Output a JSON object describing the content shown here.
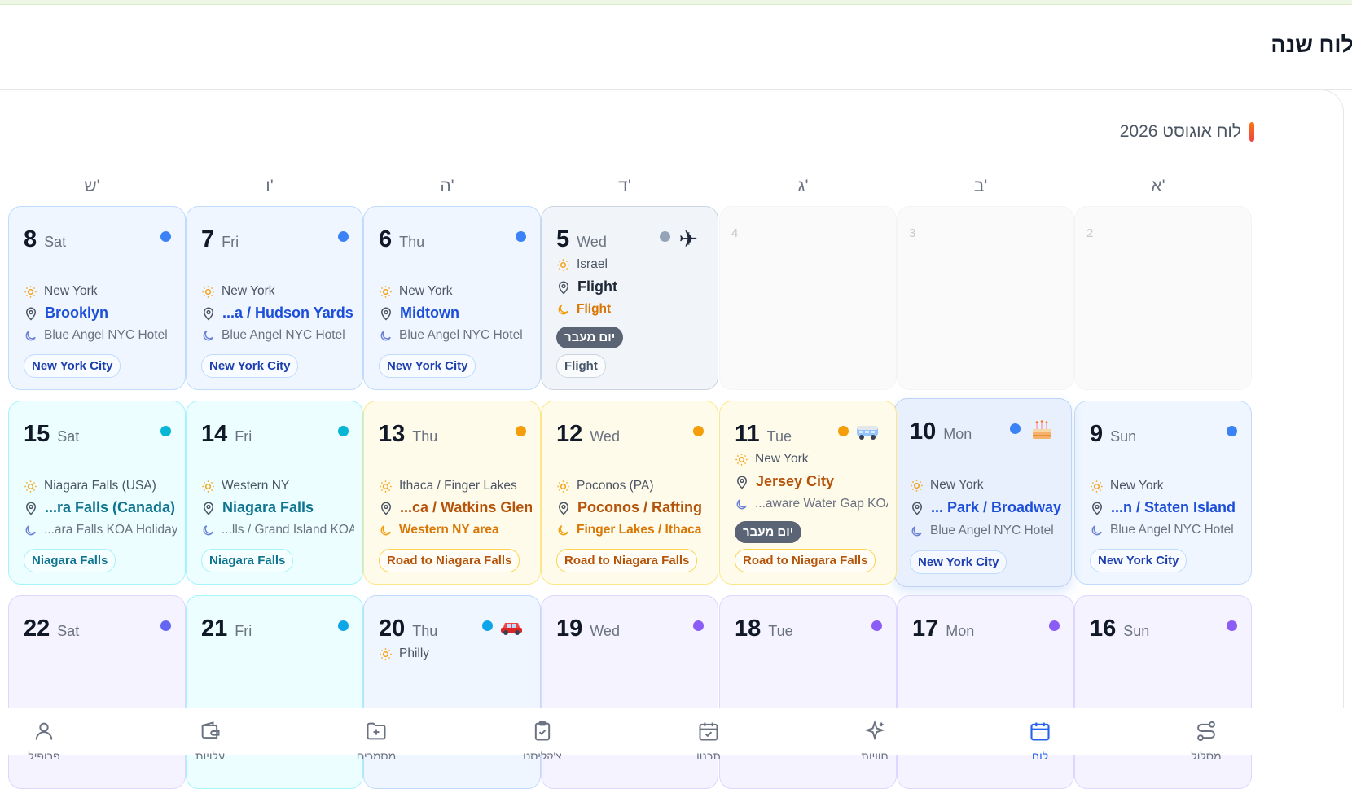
{
  "header": {
    "title": "לוח שנה"
  },
  "calendar": {
    "month_title": "לוח אוגוסט 2026",
    "weekdays": [
      "א'",
      "ב'",
      "ג'",
      "ד'",
      "ה'",
      "ו'",
      "ש'"
    ],
    "days": {
      "d2": {
        "num": "2"
      },
      "d3": {
        "num": "3"
      },
      "d4": {
        "num": "4"
      },
      "d5": {
        "num": "5",
        "name": "Wed",
        "city": "Israel",
        "location": "Flight",
        "hotel": "Flight",
        "badge": "יום מעבר",
        "tag": "Flight",
        "icon": "airplane-icon",
        "dot_color": "#94a3b8"
      },
      "d6": {
        "num": "6",
        "name": "Thu",
        "city": "New York",
        "location": "Midtown",
        "hotel": "Blue Angel NYC Hotel",
        "tag": "New York City",
        "dot_color": "#3b82f6"
      },
      "d7": {
        "num": "7",
        "name": "Fri",
        "city": "New York",
        "location": "...a / Hudson Yards",
        "hotel": "Blue Angel NYC Hotel",
        "tag": "New York City",
        "dot_color": "#3b82f6"
      },
      "d8": {
        "num": "8",
        "name": "Sat",
        "city": "New York",
        "location": "Brooklyn",
        "hotel": "Blue Angel NYC Hotel",
        "tag": "New York City",
        "dot_color": "#3b82f6"
      },
      "d9": {
        "num": "9",
        "name": "Sun",
        "city": "New York",
        "location": "...n / Staten Island",
        "hotel": "Blue Angel NYC Hotel",
        "tag": "New York City",
        "dot_color": "#3b82f6"
      },
      "d10": {
        "num": "10",
        "name": "Mon",
        "city": "New York",
        "location": "... Park / Broadway",
        "hotel": "Blue Angel NYC Hotel",
        "tag": "New York City",
        "icon": "birthday-cake-icon",
        "dot_color": "#3b82f6"
      },
      "d11": {
        "num": "11",
        "name": "Tue",
        "city": "New York",
        "location": "Jersey City",
        "hotel": "...aware Water Gap KOA",
        "badge": "יום מעבר",
        "tag": "Road to Niagara Falls",
        "icon": "minibus-icon",
        "dot_color": "#f59e0b"
      },
      "d12": {
        "num": "12",
        "name": "Wed",
        "city": "Poconos (PA)",
        "location": "Poconos / Rafting",
        "hotel": "Finger Lakes / Ithaca",
        "tag": "Road to Niagara Falls",
        "dot_color": "#f59e0b"
      },
      "d13": {
        "num": "13",
        "name": "Thu",
        "city": "Ithaca / Finger Lakes",
        "location": "...ca / Watkins Glen",
        "hotel": "Western NY area",
        "tag": "Road to Niagara Falls",
        "dot_color": "#f59e0b"
      },
      "d14": {
        "num": "14",
        "name": "Fri",
        "city": "Western NY",
        "location": "Niagara Falls",
        "hotel": "...lls / Grand Island KOA",
        "tag": "Niagara Falls",
        "dot_color": "#06b6d4"
      },
      "d15": {
        "num": "15",
        "name": "Sat",
        "city": "Niagara Falls (USA)",
        "location": "...ra Falls (Canada)",
        "hotel": "...ara Falls KOA Holiday",
        "tag": "Niagara Falls",
        "dot_color": "#06b6d4"
      },
      "d16": {
        "num": "16",
        "name": "Sun",
        "dot_color": "#8b5cf6"
      },
      "d17": {
        "num": "17",
        "name": "Mon",
        "dot_color": "#8b5cf6"
      },
      "d18": {
        "num": "18",
        "name": "Tue",
        "dot_color": "#8b5cf6"
      },
      "d19": {
        "num": "19",
        "name": "Wed",
        "dot_color": "#8b5cf6"
      },
      "d20": {
        "num": "20",
        "name": "Thu",
        "city": "Philly",
        "icon": "car-icon",
        "dot_color": "#0ea5e9"
      },
      "d21": {
        "num": "21",
        "name": "Fri",
        "dot_color": "#0ea5e9"
      },
      "d22": {
        "num": "22",
        "name": "Sat",
        "dot_color": "#6366f1"
      }
    }
  },
  "nav": [
    {
      "icon": "route-icon",
      "label": "מסלול"
    },
    {
      "icon": "calendar-icon",
      "label": "לוח",
      "active": true
    },
    {
      "icon": "sparkle-icon",
      "label": "חוויות"
    },
    {
      "icon": "calendar-check-icon",
      "label": "תכנון"
    },
    {
      "icon": "clipboard-check-icon",
      "label": "צ'קליסט"
    },
    {
      "icon": "folder-plus-icon",
      "label": "מסמכים"
    },
    {
      "icon": "wallet-icon",
      "label": "עלויות"
    },
    {
      "icon": "user-icon",
      "label": "פרופיל"
    }
  ]
}
